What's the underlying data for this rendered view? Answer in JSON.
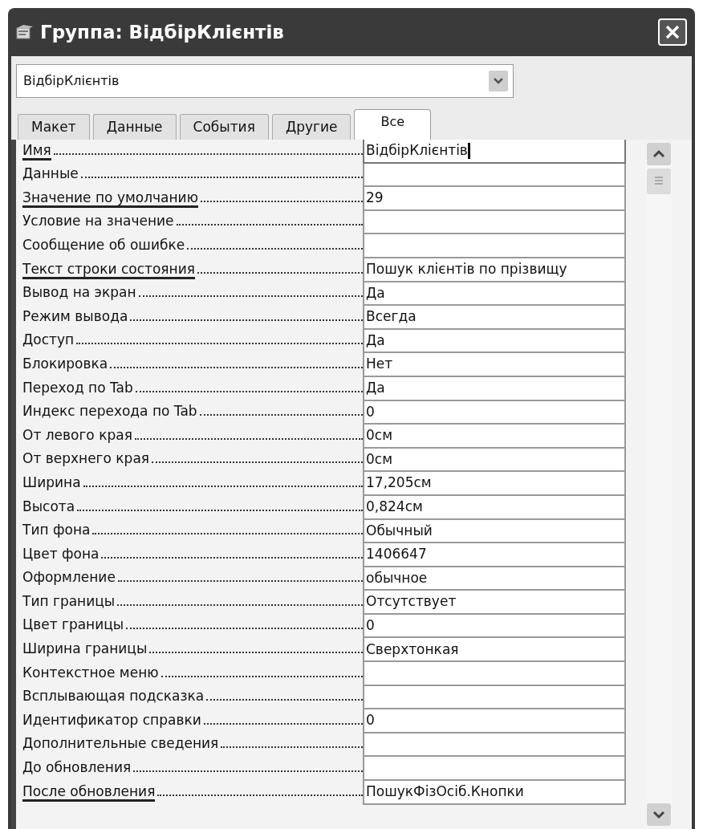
{
  "window": {
    "title": "Группа: ВідбірКлієнтів"
  },
  "object_selector": {
    "value": "ВідбірКлієнтів"
  },
  "tabs": [
    {
      "label": "Макет",
      "selected": false
    },
    {
      "label": "Данные",
      "selected": false
    },
    {
      "label": "События",
      "selected": false
    },
    {
      "label": "Другие",
      "selected": false
    },
    {
      "label": "Все",
      "selected": true
    }
  ],
  "properties": [
    {
      "name": "Имя",
      "value": "ВідбірКлієнтів",
      "marked": true,
      "focused": true
    },
    {
      "name": "Данные",
      "marked": false,
      "focused": false
    },
    {
      "name": "Значение по умолчанию",
      "value": "29",
      "marked": true,
      "focused": false
    },
    {
      "name": "Условие на значение",
      "marked": false,
      "focused": false
    },
    {
      "name": "Сообщение об ошибке",
      "marked": false,
      "focused": false
    },
    {
      "name": "Текст строки состояния",
      "value": "Пошук клієнтів по прізвищу",
      "marked": true,
      "focused": false
    },
    {
      "name": "Вывод на экран",
      "value": "Да",
      "marked": false,
      "focused": false
    },
    {
      "name": "Режим вывода",
      "value": "Всегда",
      "marked": false,
      "focused": false
    },
    {
      "name": "Доступ",
      "value": "Да",
      "marked": false,
      "focused": false
    },
    {
      "name": "Блокировка",
      "value": "Нет",
      "marked": false,
      "focused": false
    },
    {
      "name": "Переход по Tab",
      "value": "Да",
      "marked": false,
      "focused": false
    },
    {
      "name": "Индекс перехода по Tab",
      "value": "0",
      "marked": false,
      "focused": false
    },
    {
      "name": "От левого края",
      "value": "0см",
      "marked": false,
      "focused": false
    },
    {
      "name": "От верхнего края",
      "value": "0см",
      "marked": false,
      "focused": false
    },
    {
      "name": "Ширина",
      "value": "17,205см",
      "marked": false,
      "focused": false
    },
    {
      "name": "Высота",
      "value": "0,824см",
      "marked": false,
      "focused": false
    },
    {
      "name": "Тип фона",
      "value": "Обычный",
      "marked": false,
      "focused": false
    },
    {
      "name": "Цвет фона",
      "value": "1406647",
      "marked": false,
      "focused": false
    },
    {
      "name": "Оформление",
      "value": "обычное",
      "marked": false,
      "focused": false
    },
    {
      "name": "Тип границы",
      "value": "Отсутствует",
      "marked": false,
      "focused": false
    },
    {
      "name": "Цвет границы",
      "value": "0",
      "marked": false,
      "focused": false
    },
    {
      "name": "Ширина границы",
      "value": "Сверхтонкая",
      "marked": false,
      "focused": false
    },
    {
      "name": "Контекстное меню",
      "marked": false,
      "focused": false
    },
    {
      "name": "Всплывающая подсказка",
      "marked": false,
      "focused": false
    },
    {
      "name": "Идентификатор справки",
      "value": "0",
      "marked": false,
      "focused": false
    },
    {
      "name": "Дополнительные сведения",
      "marked": false,
      "focused": false
    },
    {
      "name": "До обновления",
      "marked": false,
      "focused": false
    },
    {
      "name": "После обновления",
      "value": "ПошукФізОсіб.Кнопки",
      "marked": true,
      "focused": false
    }
  ]
}
